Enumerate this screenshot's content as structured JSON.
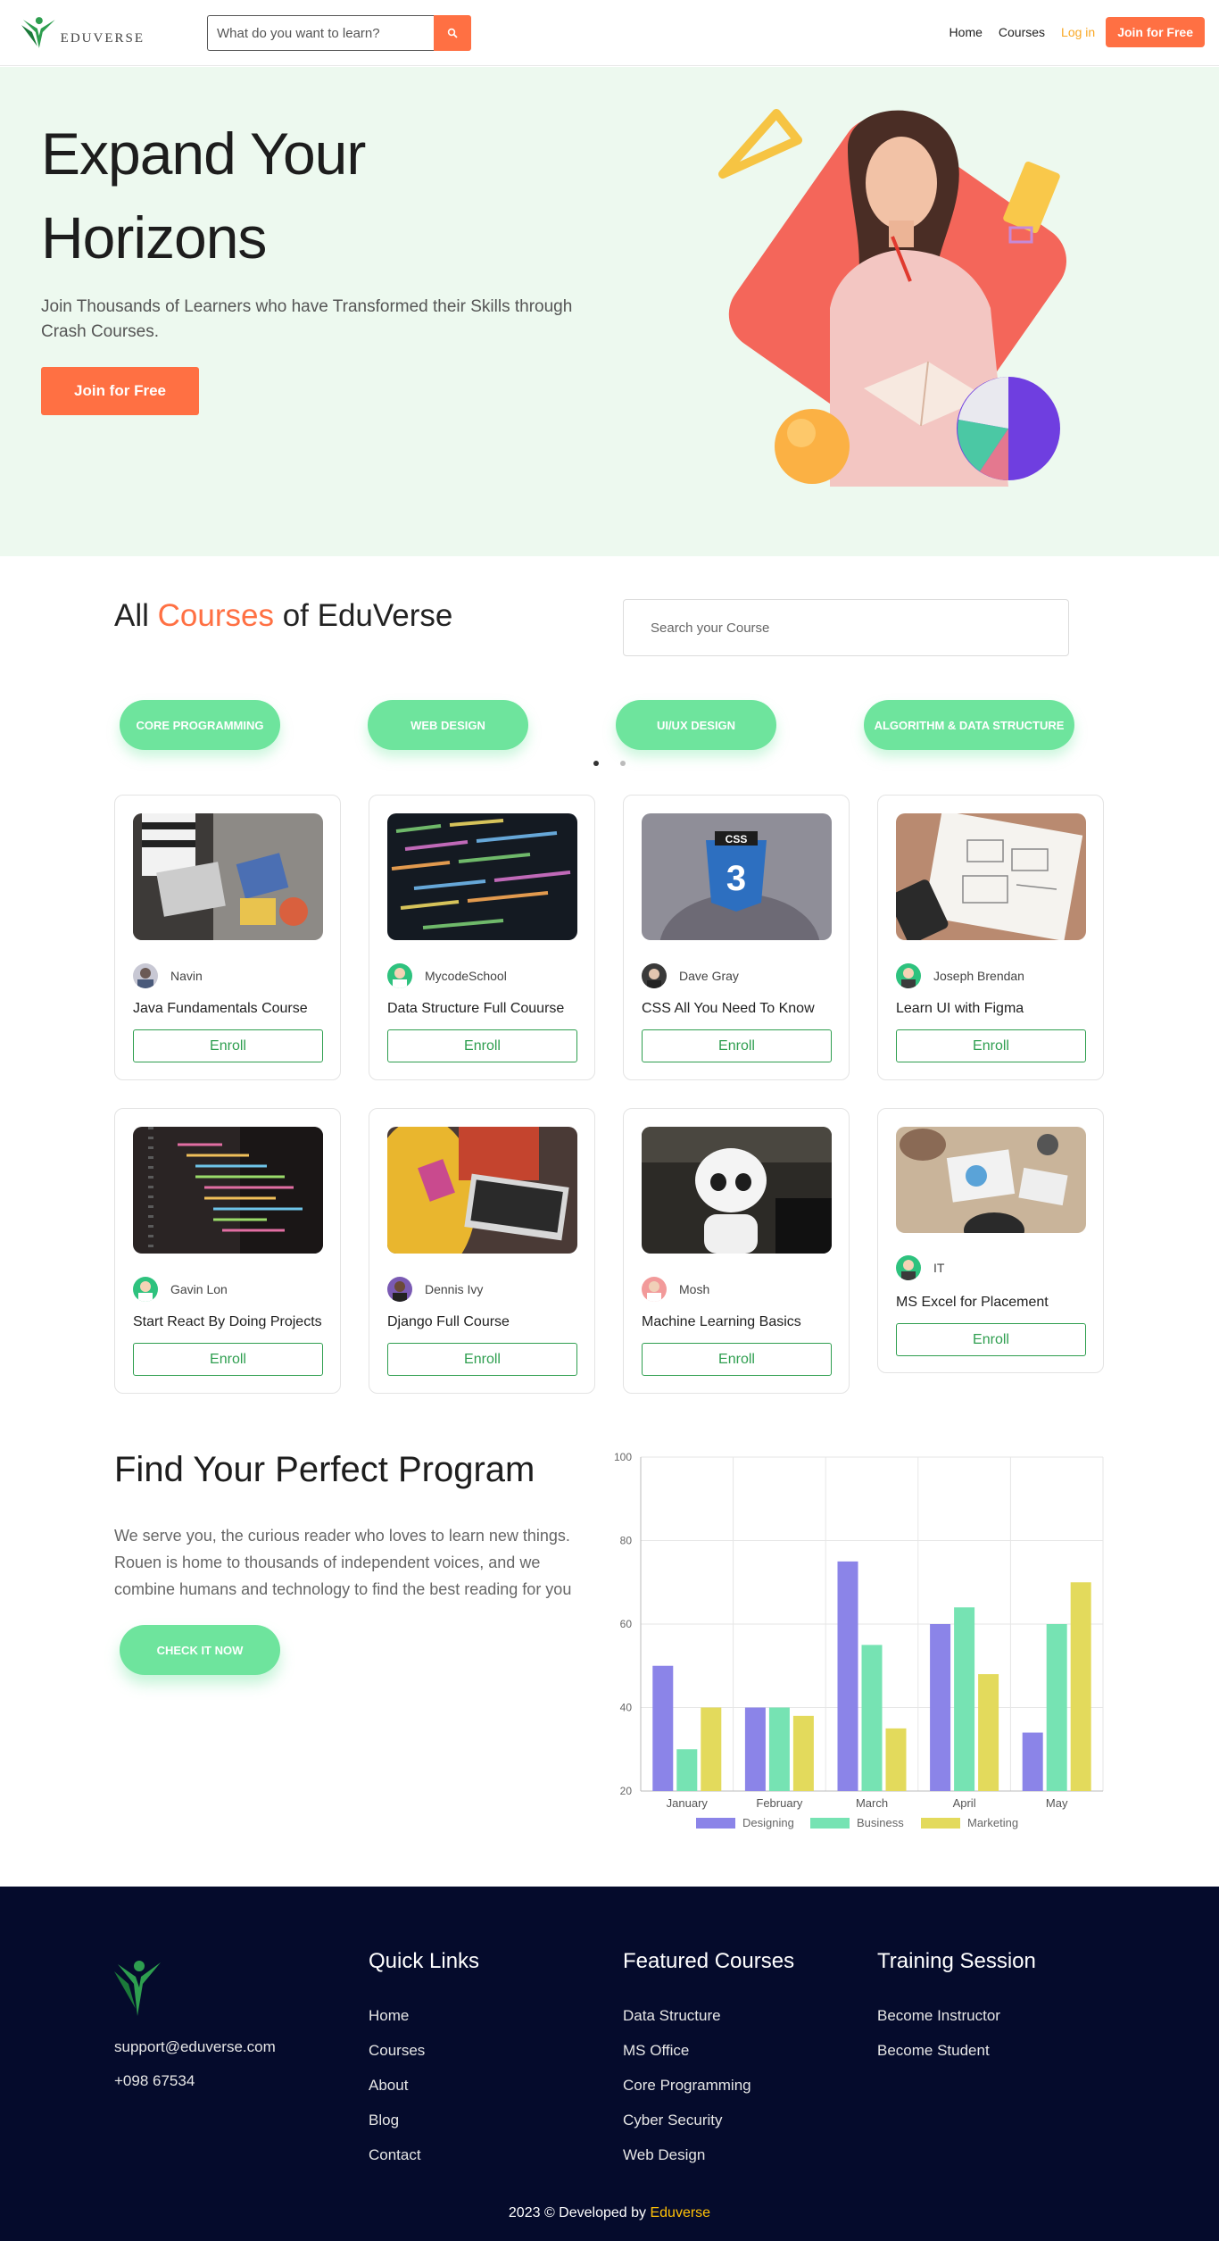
{
  "nav": {
    "logo_text": "EDUVERSE",
    "search_placeholder": "What do you want to learn?",
    "links": [
      "Home",
      "Courses"
    ],
    "login": "Log in",
    "join": "Join for Free"
  },
  "hero": {
    "title": "Expand Your Horizons",
    "subtitle": "Join Thousands of Learners who have Transformed their Skills through Crash Courses.",
    "button": "Join for Free"
  },
  "courses": {
    "title_prefix": "All",
    "title_accent": "Courses",
    "title_suffix": "of EduVerse",
    "search_placeholder": "Search your Course",
    "categories": [
      "Core Programming",
      "Web Design",
      "UI/UX Design",
      "Algorithm & Data Structure"
    ],
    "enroll_label": "Enroll",
    "items": [
      {
        "author": "Navin",
        "name": "Java Fundamentals Course"
      },
      {
        "author": "MycodeSchool",
        "name": "Data Structure Full Couurse"
      },
      {
        "author": "Dave Gray",
        "name": "CSS All You Need To Know"
      },
      {
        "author": "Joseph Brendan",
        "name": "Learn UI with Figma"
      },
      {
        "author": "Gavin Lon",
        "name": "Start React By Doing Projects"
      },
      {
        "author": "Dennis Ivy",
        "name": "Django Full Course"
      },
      {
        "author": "Mosh",
        "name": "Machine Learning Basics"
      },
      {
        "author": "IT",
        "name": "MS Excel for Placement"
      }
    ]
  },
  "program": {
    "title": "Find Your Perfect Program",
    "text": "We serve you, the curious reader who loves to learn new things. Rouen is home to thousands of independent voices, and we combine humans and technology to find the best reading for you",
    "button": "CHECK IT NOW"
  },
  "chart_data": {
    "type": "bar",
    "categories": [
      "January",
      "February",
      "March",
      "April",
      "May"
    ],
    "series": [
      {
        "name": "Designing",
        "values": [
          50,
          40,
          75,
          60,
          34
        ],
        "color": "#8b84e8"
      },
      {
        "name": "Business",
        "values": [
          30,
          40,
          55,
          64,
          60
        ],
        "color": "#76e3b3"
      },
      {
        "name": "Marketing",
        "values": [
          40,
          38,
          35,
          48,
          70
        ],
        "color": "#e3da5c"
      }
    ],
    "ylim": [
      20,
      100
    ],
    "yticks": [
      20,
      40,
      60,
      80,
      100
    ],
    "grid": true,
    "legend": "bottom"
  },
  "footer": {
    "email": "support@eduverse.com",
    "phone": "+098 67534",
    "columns": [
      {
        "title": "Quick Links",
        "items": [
          "Home",
          "Courses",
          "About",
          "Blog",
          "Contact"
        ]
      },
      {
        "title": "Featured Courses",
        "items": [
          "Data Structure",
          "MS Office",
          "Core Programming",
          "Cyber Security",
          "Web Design"
        ]
      },
      {
        "title": "Training Session",
        "items": [
          "Become Instructor",
          "Become Student"
        ]
      }
    ],
    "copyright_prefix": "2023 © Developed by",
    "brand": "Eduverse"
  },
  "colors": {
    "accent": "#ff7043",
    "green": "#6ee49d",
    "enroll": "#2e9e4f",
    "footer_bg": "#050b2c",
    "hero_bg": "#edf9ef"
  }
}
